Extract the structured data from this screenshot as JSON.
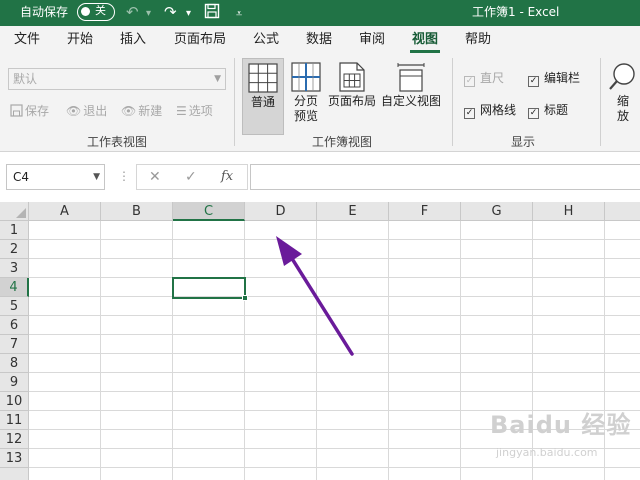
{
  "titlebar": {
    "autosave_label": "自动保存",
    "autosave_state": "关",
    "title": "工作簿1  -  Excel"
  },
  "tabs": [
    "文件",
    "开始",
    "插入",
    "页面布局",
    "公式",
    "数据",
    "审阅",
    "视图",
    "帮助"
  ],
  "active_tab": "视图",
  "ribbon": {
    "sheet_view": {
      "combo_value": "默认",
      "keep": "保存",
      "exit": "退出",
      "new": "新建",
      "options": "选项",
      "group_label": "工作表视图"
    },
    "workbook_views": {
      "normal": "普通",
      "page_break_line1": "分页",
      "page_break_line2": "预览",
      "page_layout": "页面布局",
      "custom_views": "自定义视图",
      "group_label": "工作簿视图"
    },
    "show": {
      "ruler": "直尺",
      "formula_bar": "编辑栏",
      "gridlines": "网格线",
      "headings": "标题",
      "group_label": "显示"
    },
    "zoom": {
      "line1": "缩",
      "line2": "放"
    }
  },
  "formula_bar": {
    "name_box": "C4",
    "cancel_glyph": "✕",
    "enter_glyph": "✓",
    "fx_label": "fx",
    "value": ""
  },
  "sheet": {
    "columns": [
      "A",
      "B",
      "C",
      "D",
      "E",
      "F",
      "G",
      "H"
    ],
    "rows": [
      "1",
      "2",
      "3",
      "4",
      "5",
      "6",
      "7",
      "8",
      "9",
      "10",
      "11",
      "12",
      "13"
    ],
    "active_cell": "C4"
  },
  "watermark": {
    "logo": "Baidu 经验",
    "url": "jingyan.baidu.com"
  },
  "colors": {
    "excel_green": "#217346",
    "annotation_arrow": "#6a1b9a"
  }
}
